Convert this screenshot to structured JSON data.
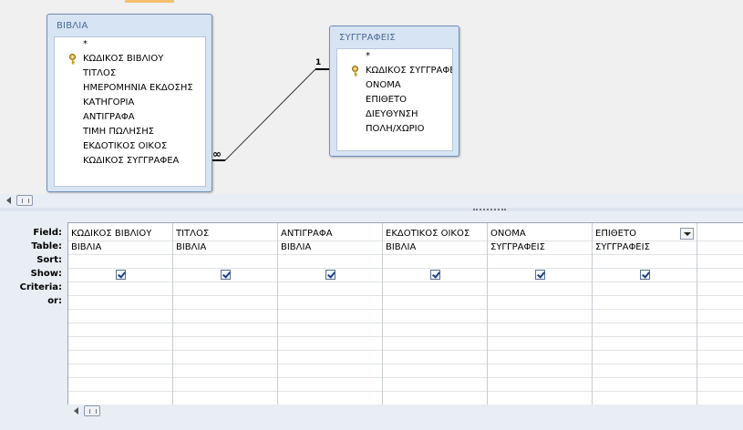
{
  "tables": [
    {
      "title": "ΒΙΒΛΙΑ",
      "fields": [
        "*",
        "ΚΩΔΙΚΟΣ ΒΙΒΛΙΟΥ",
        "ΤΙΤΛΟΣ",
        "ΗΜΕΡΟΜΗΝΙΑ ΕΚΔΟΣΗΣ",
        "ΚΑΤΗΓΟΡΙΑ",
        "ΑΝΤΙΓΡΑΦΑ",
        "ΤΙΜΗ ΠΩΛΗΣΗΣ",
        "ΕΚΔΟΤΙΚΟΣ ΟΙΚΟΣ",
        "ΚΩΔΙΚΟΣ ΣΥΓΓΡΑΦΕΑ"
      ]
    },
    {
      "title": "ΣΥΓΓΡΑΦΕΙΣ",
      "fields": [
        "*",
        "ΚΩΔΙΚΟΣ ΣΥΓΓΡΑΦΕΑ",
        "ΟΝΟΜΑ",
        "ΕΠΙΘΕΤΟ",
        "ΔΙΕΥΘΥΝΣΗ",
        "ΠΟΛΗ/ΧΩΡΙΟ"
      ]
    }
  ],
  "relationship": {
    "one_label": "1",
    "many_label": "∞"
  },
  "grid": {
    "row_labels": {
      "field": "Field:",
      "table": "Table:",
      "sort": "Sort:",
      "show": "Show:",
      "criteria": "Criteria:",
      "or": "or:"
    },
    "columns": [
      {
        "field": "ΚΩΔΙΚΟΣ ΒΙΒΛΙΟΥ",
        "table": "ΒΙΒΛΙΑ",
        "show": true
      },
      {
        "field": "ΤΙΤΛΟΣ",
        "table": "ΒΙΒΛΙΑ",
        "show": true
      },
      {
        "field": "ΑΝΤΙΓΡΑΦΑ",
        "table": "ΒΙΒΛΙΑ",
        "show": true
      },
      {
        "field": "ΕΚΔΟΤΙΚΟΣ ΟΙΚΟΣ",
        "table": "ΒΙΒΛΙΑ",
        "show": true
      },
      {
        "field": "ΟΝΟΜΑ",
        "table": "ΣΥΓΓΡΑΦΕΙΣ",
        "show": true
      },
      {
        "field": "ΕΠΙΘΕΤΟ",
        "table": "ΣΥΓΓΡΑΦΕΙΣ",
        "show": true
      }
    ]
  },
  "colors": {
    "table_header": "#d7e4f3",
    "grid_bg": "#ffffff",
    "check": "#1c3f8a"
  }
}
